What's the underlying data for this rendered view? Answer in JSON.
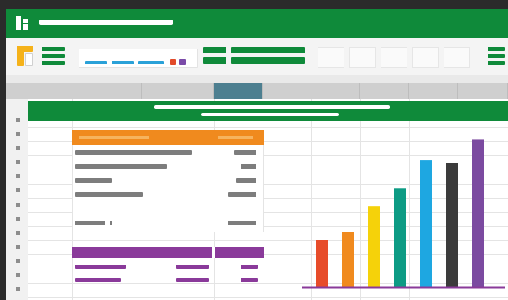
{
  "window": {
    "title": ""
  },
  "colors": {
    "brand": "#0f8a3a",
    "header_orange": "#f08a1e",
    "footer_purple": "#8a3a9a",
    "active_column": "#4d7f90"
  },
  "icons": [
    "app-logo-icon",
    "paste-icon",
    "table-format-icon"
  ],
  "chart_data": {
    "type": "bar",
    "categories": [
      "",
      "",
      "",
      "",
      "",
      "",
      ""
    ],
    "values": [
      63,
      74,
      109,
      132,
      170,
      166,
      198
    ],
    "colors": [
      "#e74c2a",
      "#f08a1e",
      "#f5d20a",
      "#0d9b84",
      "#1ea7e1",
      "#3b3b3b",
      "#7b4aa0"
    ],
    "ylim": [
      0,
      210
    ],
    "grid": false
  }
}
